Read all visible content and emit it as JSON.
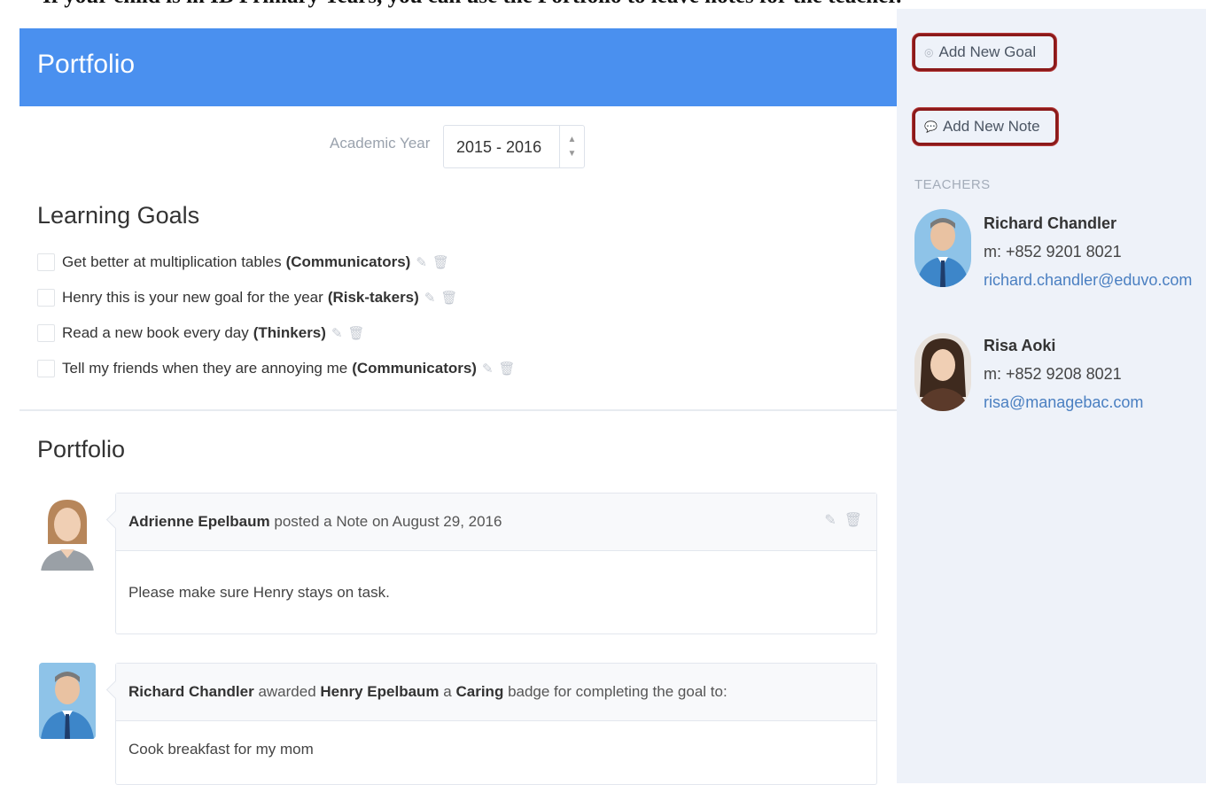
{
  "caption": "If your child is in IB Primary Years, you can use the Portfolio to leave notes for the teacher.",
  "header": {
    "title": "Portfolio"
  },
  "academic_year": {
    "label": "Academic Year",
    "value": "2015 - 2016"
  },
  "learning_goals": {
    "title": "Learning Goals",
    "items": [
      {
        "text": "Get better at multiplication tables",
        "tag": "(Communicators)"
      },
      {
        "text": "Henry this is your new goal for the year",
        "tag": "(Risk-takers)"
      },
      {
        "text": "Read a new book every day",
        "tag": "(Thinkers)"
      },
      {
        "text": "Tell my friends when they are annoying me",
        "tag": "(Communicators)"
      }
    ]
  },
  "portfolio": {
    "title": "Portfolio",
    "posts": [
      {
        "author": "Adrienne Epelbaum",
        "action": "posted a Note on August 29, 2016",
        "body": "Please make sure Henry stays on task."
      },
      {
        "author": "Richard Chandler",
        "verb": "awarded",
        "student": "Henry Epelbaum",
        "article": "a",
        "badge": "Caring",
        "rest": "badge for completing the goal to:",
        "body": "Cook breakfast for my mom"
      }
    ]
  },
  "sidebar": {
    "add_goal": "Add New Goal",
    "add_note": "Add New Note",
    "teachers_label": "TEACHERS",
    "teachers": [
      {
        "name": "Richard Chandler",
        "phone": "m: +852 9201 8021",
        "email": "richard.chandler@eduvo.com"
      },
      {
        "name": "Risa Aoki",
        "phone": "m: +852 9208 8021",
        "email": "risa@managebac.com"
      }
    ]
  },
  "colors": {
    "header": "#4a90ef",
    "sidebar_bg": "#eef2f9",
    "highlight_border": "#8b1a1a",
    "link": "#4a7fc1"
  },
  "icons": {
    "edit": "pencil-icon",
    "delete": "trash-icon",
    "goal": "target-icon",
    "note": "speech-bubble-icon"
  }
}
